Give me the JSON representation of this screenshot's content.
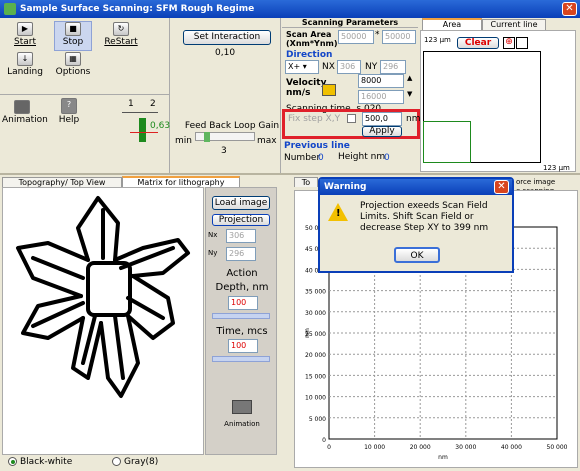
{
  "window": {
    "title": "Sample Surface Scanning: SFM Rough Regime",
    "close": "✕"
  },
  "toolbar": {
    "start": "Start",
    "stop": "Stop",
    "restart": "ReStart",
    "landing": "Landing",
    "options": "Options",
    "animation": "Animation",
    "help": "Help"
  },
  "scale": {
    "a": "1",
    "b": "2",
    "value": "0,63"
  },
  "interaction": {
    "button": "Set Interaction",
    "value": "0,10"
  },
  "feedback": {
    "label": "Feed Back Loop Gain",
    "min": "min",
    "max": "max",
    "value": "3"
  },
  "scan": {
    "header": "Scanning Parameters",
    "area_label": "Scan Area (Xnm*Ynm)",
    "x": "50000",
    "y": "50000",
    "direction_label": "Direction",
    "direction": "X+",
    "nx_label": "NX",
    "nx": "306",
    "ny_label": "NY",
    "ny": "296",
    "velocity_label": "Velocity nm/s",
    "v1": "8000",
    "v2": "16000",
    "scan_time": "Scanning time, s   020",
    "fix_label": "Fix step X,Y",
    "fix_value": "500,0",
    "fix_unit": "nm",
    "apply": "Apply",
    "prev": "Previous  line",
    "number_label": "Number",
    "number": "0",
    "height_label": "Height nm",
    "height": "0"
  },
  "area": {
    "tab1": "Area",
    "tab2": "Current line",
    "size": "123 µm",
    "clear": "Clear",
    "size2": "123 µm"
  },
  "left": {
    "tab1": "Topography/ Top View",
    "tab2": "Matrix for lithography",
    "radio1": "Black-white",
    "radio2": "Gray(8)"
  },
  "controls": {
    "load": "Load image",
    "projection": "Projection",
    "nx_label": "Nx",
    "nx": "306",
    "ny_label": "Ny",
    "ny": "296",
    "action": "Action",
    "depth": "Depth, nm",
    "depth_val": "100",
    "time": "Time,   mcs",
    "time_val": "100",
    "animation": "Animation"
  },
  "chart_tabs": {
    "t1": "To",
    "t2": "orce image",
    "t3": "e scanning"
  },
  "warning": {
    "title": "Warning",
    "message": "Projection exeeds Scan Field Limits. Shift Scan Field or decrease Step XY to 399  nm",
    "ok": "OK"
  },
  "chart_data": {
    "type": "line",
    "xlabel": "nm",
    "ylabel": "nm",
    "xlim": [
      0,
      50000
    ],
    "ylim": [
      0,
      50000
    ],
    "x_ticks": [
      "0",
      "10 000",
      "20 000",
      "30 000",
      "40 000",
      "50 000"
    ],
    "y_ticks": [
      "0",
      "5 000",
      "10 000",
      "15 000",
      "20 000",
      "25 000",
      "30 000",
      "35 000",
      "40 000",
      "45 000",
      "50 000"
    ],
    "grid": true,
    "series": []
  }
}
